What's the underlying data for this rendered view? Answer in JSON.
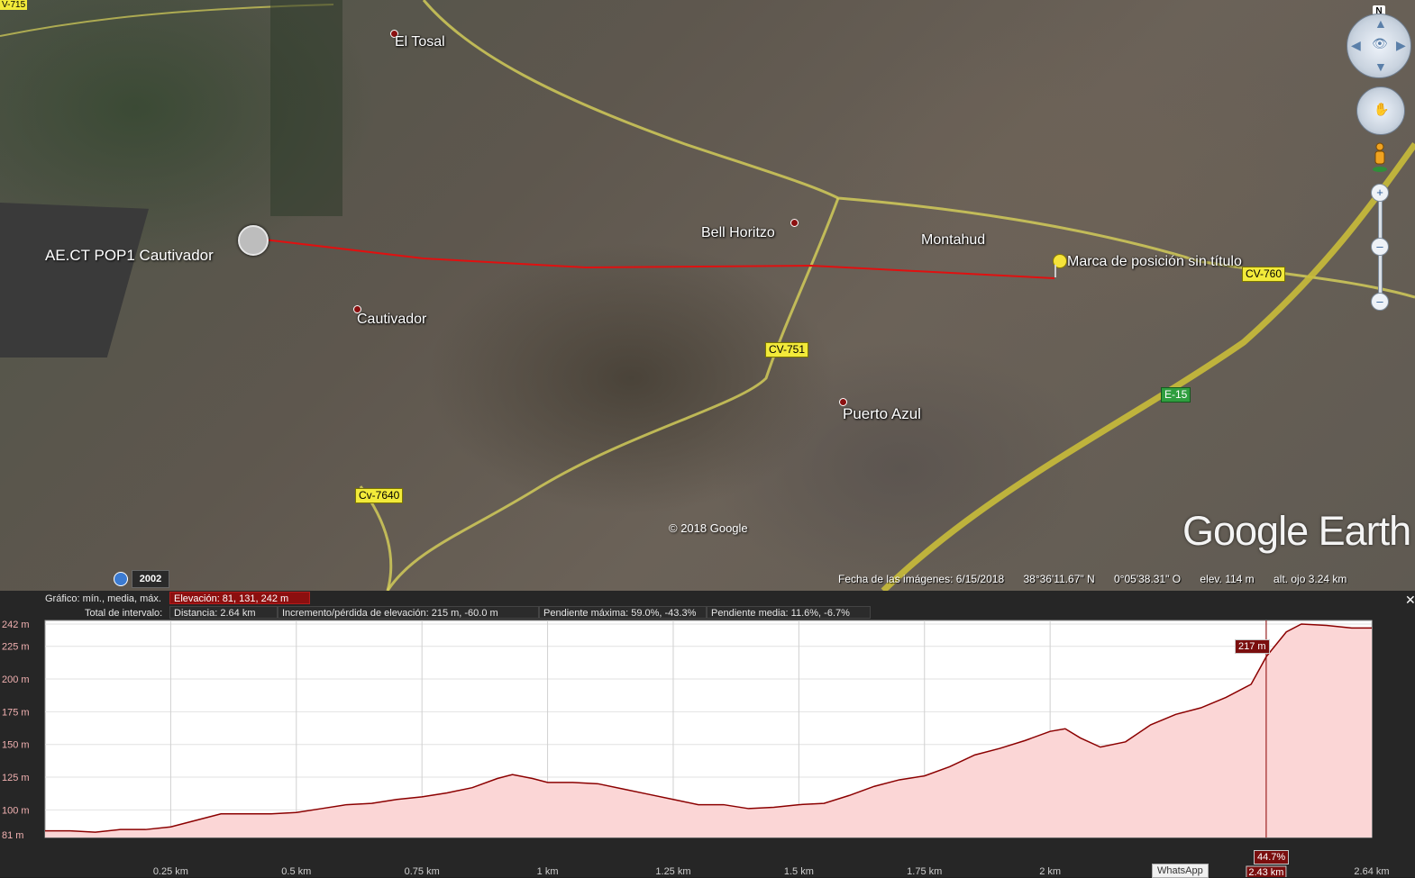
{
  "map": {
    "corner_tag": "V-715",
    "places": {
      "el_tosal": "El Tosal",
      "bell_horitzo": "Bell Horitzo",
      "montahud": "Montahud",
      "cautivador": "Cautivador",
      "puerto_azul": "Puerto Azul",
      "ae_ct": "AE.CT POP1 Cautivador",
      "marca": "Marca de posición sin título"
    },
    "roads": {
      "cv751": "CV-751",
      "cv760": "CV-760",
      "cv7640": "Cv-7640",
      "e15": "E-15"
    },
    "copyright": "© 2018 Google",
    "logo": "Google Earth",
    "year": "2002",
    "status": {
      "date": "Fecha de las imágenes: 6/15/2018",
      "lat": "38°36'11.67\" N",
      "lon": "0°05'38.31\" O",
      "elev": "elev.   114 m",
      "eye": "alt. ojo   3.24 km"
    },
    "north": "N"
  },
  "elevation_panel": {
    "row1_label": "Gráfico: mín., media, máx.",
    "row1_value": "Elevación: 81, 131, 242 m",
    "row2_label": "Total de intervalo:",
    "distance": "Distancia: 2.64 km",
    "gain": "Incremento/pérdida de elevación: 215 m, -60.0 m",
    "max_slope": "Pendiente máxima: 59.0%, -43.3%",
    "avg_slope": "Pendiente media: 11.6%, -6.7%",
    "cursor_elev": "217 m",
    "cursor_slope": "44.7%",
    "cursor_dist": "2.43 km",
    "taskbar_tooltip": "WhatsApp"
  },
  "chart_data": {
    "type": "area",
    "xlabel": "",
    "ylabel": "",
    "xlim": [
      0,
      2.64
    ],
    "ylim": [
      81,
      242
    ],
    "x_ticks": [
      "0.25 km",
      "0.5 km",
      "0.75 km",
      "1 km",
      "1.25 km",
      "1.5 km",
      "1.75 km",
      "2 km",
      "2.43 km",
      "2.64 km"
    ],
    "x_tick_values": [
      0.25,
      0.5,
      0.75,
      1.0,
      1.25,
      1.5,
      1.75,
      2.0,
      2.43,
      2.64
    ],
    "y_ticks": [
      "242 m",
      "225 m",
      "200 m",
      "175 m",
      "150 m",
      "125 m",
      "100 m",
      "81 m"
    ],
    "y_tick_values": [
      242,
      225,
      200,
      175,
      150,
      125,
      100,
      81
    ],
    "series": [
      {
        "x": [
          0,
          0.05,
          0.1,
          0.15,
          0.2,
          0.25,
          0.3,
          0.35,
          0.4,
          0.45,
          0.5,
          0.55,
          0.6,
          0.65,
          0.7,
          0.75,
          0.8,
          0.85,
          0.9,
          0.93,
          0.97,
          1.0,
          1.05,
          1.1,
          1.15,
          1.2,
          1.25,
          1.3,
          1.35,
          1.4,
          1.45,
          1.5,
          1.55,
          1.6,
          1.65,
          1.7,
          1.75,
          1.8,
          1.85,
          1.9,
          1.95,
          2.0,
          2.03,
          2.06,
          2.1,
          2.15,
          2.2,
          2.25,
          2.3,
          2.35,
          2.4,
          2.43,
          2.47,
          2.5,
          2.55,
          2.6,
          2.64
        ],
        "y": [
          84,
          84,
          83,
          85,
          85,
          87,
          92,
          97,
          97,
          97,
          98,
          101,
          104,
          105,
          108,
          110,
          113,
          117,
          124,
          127,
          124,
          121,
          121,
          120,
          116,
          112,
          108,
          104,
          104,
          101,
          102,
          104,
          105,
          111,
          118,
          123,
          126,
          133,
          142,
          147,
          153,
          160,
          162,
          155,
          148,
          152,
          165,
          173,
          178,
          186,
          196,
          217,
          236,
          242,
          241,
          239,
          239
        ]
      }
    ],
    "cursor_x": 2.43,
    "fill_color": "#fbd6d6",
    "line_color": "#8b0000",
    "grid": true
  }
}
